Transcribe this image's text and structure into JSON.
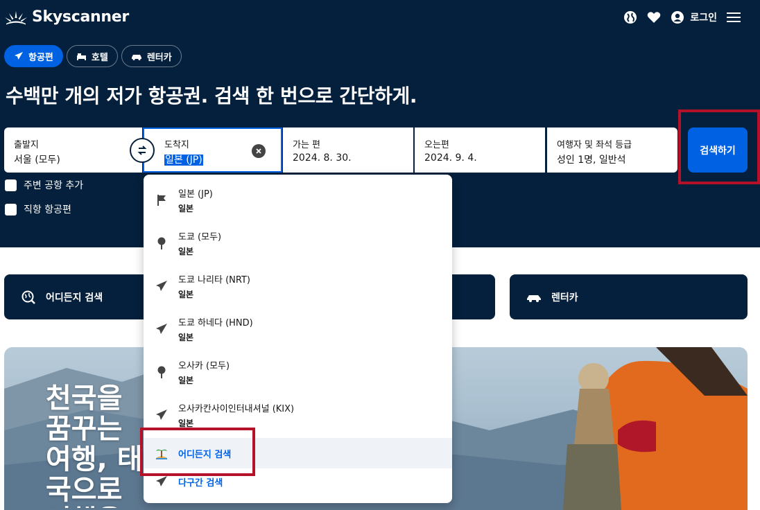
{
  "brand": {
    "name": "Skyscanner"
  },
  "topnav": {
    "login_label": "로그인"
  },
  "chips": [
    {
      "label": "항공편"
    },
    {
      "label": "호텔"
    },
    {
      "label": "렌터카"
    }
  ],
  "headline": "수백만 개의 저가 항공권. 검색 한 번으로 간단하게.",
  "search": {
    "origin_label": "출발지",
    "origin_value": "서울 (모두)",
    "dest_label": "도착지",
    "dest_value": "일본 (JP)",
    "depart_label": "가는 편",
    "depart_value": "2024. 8. 30.",
    "return_label": "오는편",
    "return_value": "2024. 9. 4.",
    "travellers_label": "여행자 및 좌석 등급",
    "travellers_value": "성인 1명, 일반석",
    "button_label": "검색하기"
  },
  "options": {
    "nearby_airports": "주변 공항 추가",
    "direct_flights": "직항 항공편"
  },
  "tiles": [
    {
      "label": "어디든지 검색"
    },
    {
      "label": ""
    },
    {
      "label": "렌터카"
    }
  ],
  "banner": {
    "text": "천국을 꿈꾸는 여행, 태국으로 여행을 떠날 준비 하세요"
  },
  "dropdown": {
    "items": [
      {
        "name": "일본 (JP)",
        "sub": "일본",
        "icon": "flag-icon"
      },
      {
        "name": "도쿄 (모두)",
        "sub": "일본",
        "icon": "pin-icon"
      },
      {
        "name": "도쿄 나리타 (NRT)",
        "sub": "일본",
        "icon": "plane-icon"
      },
      {
        "name": "도쿄 하네다 (HND)",
        "sub": "일본",
        "icon": "plane-icon"
      },
      {
        "name": "오사카 (모두)",
        "sub": "일본",
        "icon": "pin-icon"
      },
      {
        "name": "오사카칸사이인터내셔널 (KIX)",
        "sub": "일본",
        "icon": "plane-icon"
      }
    ],
    "search_everywhere": "어디든지 검색",
    "multi_city": "다구간 검색"
  },
  "colors": {
    "navy": "#05203c",
    "accent": "#0062e3",
    "highlight_box": "#b5122a"
  }
}
